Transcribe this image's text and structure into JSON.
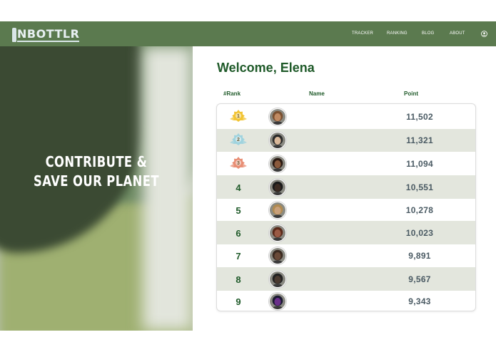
{
  "brand": {
    "logo_text": "NBOTTLR"
  },
  "nav": {
    "links": [
      "TRACKER",
      "RANKING",
      "BLOG",
      "ABOUT"
    ],
    "user_icon": "user-circle-icon"
  },
  "hero": {
    "line1": "CONTRIBUTE &",
    "line2": "SAVE OUR PLANET"
  },
  "leaderboard": {
    "welcome": "Welcome, Elena",
    "headers": {
      "rank": "#Rank",
      "name": "Name",
      "points": "Point"
    },
    "rows": [
      {
        "rank": "1",
        "medal": "gold",
        "points": "11,502"
      },
      {
        "rank": "2",
        "medal": "silver",
        "points": "11,321"
      },
      {
        "rank": "3",
        "medal": "bronze",
        "points": "11,094"
      },
      {
        "rank": "4",
        "medal": "",
        "points": "10,551"
      },
      {
        "rank": "5",
        "medal": "",
        "points": "10,278"
      },
      {
        "rank": "6",
        "medal": "",
        "points": "10,023"
      },
      {
        "rank": "7",
        "medal": "",
        "points": "9,891"
      },
      {
        "rank": "8",
        "medal": "",
        "points": "9,567"
      },
      {
        "rank": "9",
        "medal": "",
        "points": "9,343"
      }
    ]
  },
  "colors": {
    "nav_bg": "#5b7a4f",
    "accent_green": "#1f5a29",
    "row_shade": "#e3e6dd",
    "gold": "#f2c433",
    "silver": "#9fd3de",
    "bronze": "#e88e74"
  }
}
